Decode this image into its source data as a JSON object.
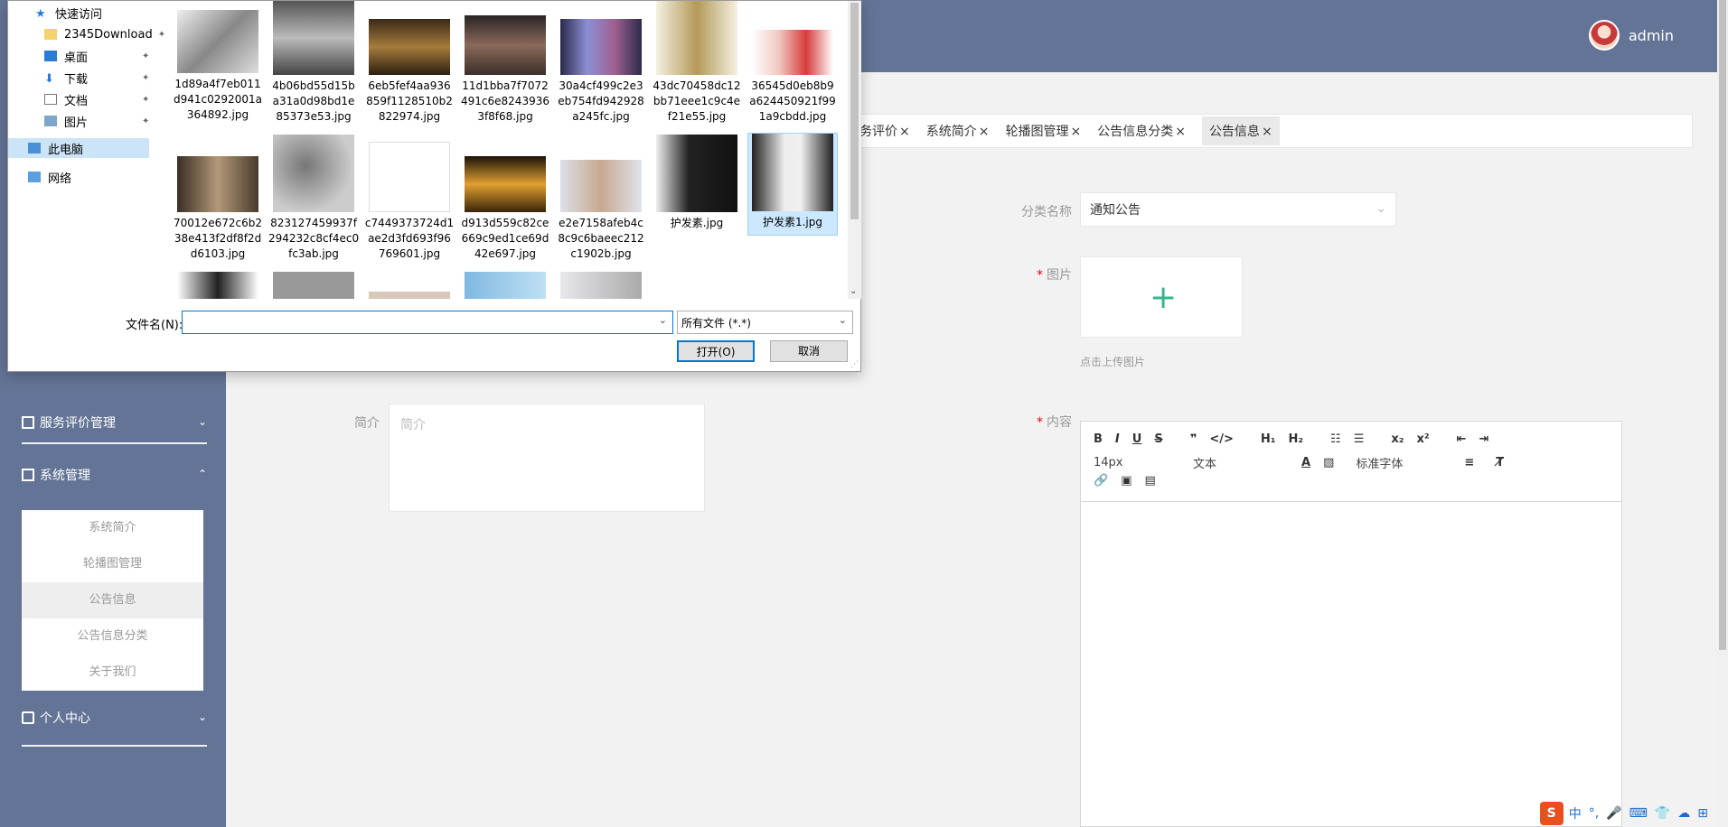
{
  "header": {
    "username": "admin"
  },
  "sidebar": {
    "menu": [
      {
        "label": "服务评价管理",
        "chev": "⌄"
      },
      {
        "label": "系统管理",
        "chev": "⌃"
      },
      {
        "label": "个人中心",
        "chev": "⌄"
      }
    ],
    "submenu": [
      "系统简介",
      "轮播图管理",
      "公告信息",
      "公告信息分类",
      "关于我们"
    ],
    "active_submenu": "公告信息"
  },
  "tabs": [
    {
      "label": "务评价"
    },
    {
      "label": "系统简介"
    },
    {
      "label": "轮播图管理"
    },
    {
      "label": "公告信息分类"
    },
    {
      "label": "公告信息"
    }
  ],
  "form": {
    "category_label": "分类名称",
    "category_value": "通知公告",
    "image_label": "图片",
    "upload_hint": "点击上传图片",
    "summary_label": "简介",
    "summary_placeholder": "简介",
    "content_label": "内容",
    "editor": {
      "row1": [
        "B",
        "I",
        "U",
        "S",
        "❞",
        "</>",
        "H₁",
        "H₂",
        "☷",
        "☰",
        "x₂",
        "x²",
        "⇤",
        "⇥"
      ],
      "font_size": "14px",
      "text_type": "文本",
      "font_family": "标准字体"
    }
  },
  "dialog": {
    "nav": [
      {
        "label": "快速访问",
        "icon": "star-icon"
      },
      {
        "label": "2345Download",
        "icon": "folder-icon"
      },
      {
        "label": "桌面",
        "icon": "desktop-icon"
      },
      {
        "label": "下载",
        "icon": "download-icon"
      },
      {
        "label": "文档",
        "icon": "document-icon"
      },
      {
        "label": "图片",
        "icon": "picture-icon"
      },
      {
        "label": "此电脑",
        "icon": "computer-icon"
      },
      {
        "label": "网络",
        "icon": "network-icon"
      }
    ],
    "files": [
      {
        "name": "1d89a4f7eb011\nd941c0292001a\n364892.jpg"
      },
      {
        "name": "4b06bd55d15b\na31a0d98bd1e\n85373e53.jpg"
      },
      {
        "name": "6eb5fef4aa936\n859f1128510b2\n822974.jpg"
      },
      {
        "name": "11d1bba7f7072\n491c6e8243936\n3f8f68.jpg"
      },
      {
        "name": "30a4cf499c2e3\neb754fd942928\na245fc.jpg"
      },
      {
        "name": "43dc70458dc12\nbb71eee1c9c4e\nf21e55.jpg"
      },
      {
        "name": "36545d0eb8b9\na624450921f99\n1a9cbdd.jpg"
      },
      {
        "name": "70012e672c6b2\n38e413f2df8f2d\nd6103.jpg"
      },
      {
        "name": "823127459937f\n294232c8cf4ec0\nfc3ab.jpg"
      },
      {
        "name": "c7449373724d1\nae2d3fd693f96\n769601.jpg"
      },
      {
        "name": "d913d559c82ce\n669c9ed1ce69d\n42e697.jpg"
      },
      {
        "name": "e2e7158afeb4c\n8c9c6baeec212\nc1902b.jpg"
      },
      {
        "name": "护发素.jpg"
      },
      {
        "name": "护发素1.jpg"
      }
    ],
    "filename_label": "文件名(N):",
    "filename_value": "",
    "filetype": "所有文件 (*.*)",
    "open_label": "打开(O)",
    "cancel_label": "取消"
  },
  "ime": [
    "中",
    "°,",
    "🎤",
    "⌨",
    "👕",
    "☁",
    "⊞"
  ],
  "colors": {
    "sidebar": "#647496",
    "accent": "#35b58d",
    "required": "#e60012",
    "dialog_select": "#cce8ff"
  }
}
